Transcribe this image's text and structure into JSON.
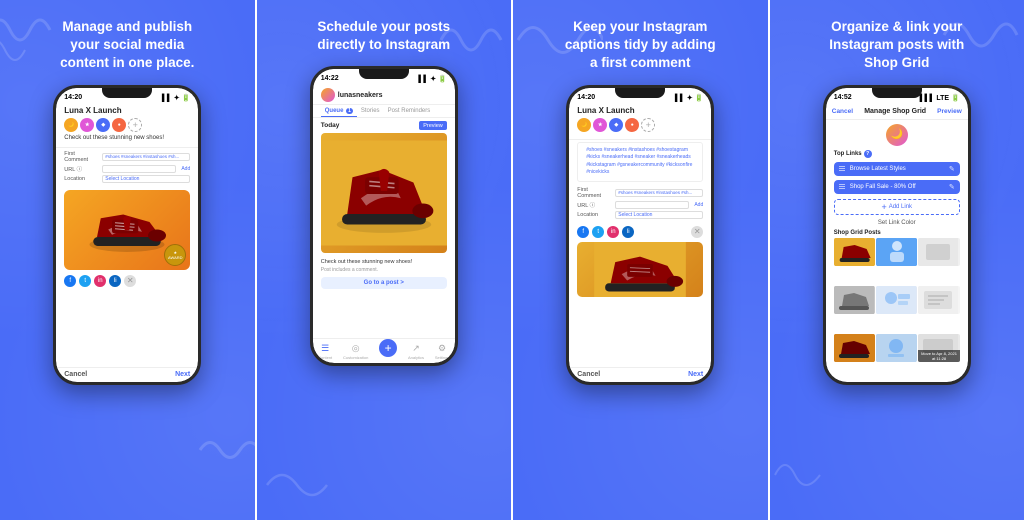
{
  "panels": [
    {
      "id": "panel1",
      "title": "Manage and publish your social media content in one place.",
      "screen": {
        "statusbar": {
          "time": "14:20",
          "signal": "▌▌▌",
          "wifi": "▾",
          "battery": "▮"
        },
        "header_title": "Luna X Launch",
        "caption": "Check out these stunning new shoes!",
        "tags": "",
        "fields": [
          {
            "label": "First Comment",
            "placeholder": "#shoes #sneakers #instashoes #sh..."
          },
          {
            "label": "URL ⓘ",
            "placeholder": "",
            "has_add": true
          },
          {
            "label": "Location",
            "placeholder": "Select Location"
          }
        ],
        "social": [
          "f",
          "t",
          "in",
          "li"
        ],
        "social_colors": [
          "#1877F2",
          "#1DA1F2",
          "#E1306C",
          "#0A66C2"
        ]
      },
      "bottom": {
        "cancel": "Cancel",
        "next": "Next"
      }
    },
    {
      "id": "panel2",
      "title": "Schedule your posts directly to Instagram",
      "screen": {
        "statusbar": {
          "time": "14:22"
        },
        "profile_name": "lunasneakers",
        "tabs": [
          "Queue",
          "Stories",
          "Post Reminders"
        ],
        "active_tab": 0,
        "queue_badge": "1",
        "section": "Today",
        "caption": "Check out these stunning new shoes!",
        "caption_sub": "Post includes a comment.",
        "goto_label": "Go to a post >"
      },
      "navbar": [
        {
          "icon": "☰",
          "label": "Content",
          "active": true
        },
        {
          "icon": "◎",
          "label": "Customization"
        },
        {
          "icon": "+",
          "label": "",
          "is_plus": true
        },
        {
          "icon": "↗",
          "label": "Analytics"
        },
        {
          "icon": "⚙",
          "label": "Settings"
        }
      ]
    },
    {
      "id": "panel3",
      "title": "Keep your Instagram captions tidy by adding a first comment",
      "screen": {
        "statusbar": {
          "time": "14:20"
        },
        "header_title": "Luna X Launch",
        "tags_text": "#shoes #sneakers #instashoes #shoestagram #kicks #sneakerhead #sneaker #sneakerheads #kickstagram #gsneakercommunity #kicksonfire #nicekicks",
        "fields": [
          {
            "label": "First Comment",
            "placeholder": "#shoes #sneakers #instashoes #sh..."
          },
          {
            "label": "URL ⓘ",
            "placeholder": "",
            "has_add": true
          },
          {
            "label": "Location",
            "placeholder": "Select Location"
          }
        ],
        "social": [
          "f",
          "t",
          "in",
          "li"
        ],
        "social_colors": [
          "#1877F2",
          "#1DA1F2",
          "#E1306C",
          "#0A66C2"
        ]
      },
      "bottom": {
        "cancel": "Cancel",
        "next": "Next"
      }
    },
    {
      "id": "panel4",
      "title": "Organize & link your Instagram posts with Shop Grid",
      "screen": {
        "statusbar": {
          "time": "14:52"
        },
        "header": {
          "cancel": "Cancel",
          "title": "Manage Shop Grid",
          "preview": "Preview"
        },
        "top_links_title": "Top Links",
        "links": [
          {
            "text": "Browse Latest Styles"
          },
          {
            "text": "Shop Fall Sale - 80% Off"
          }
        ],
        "add_link": "Add Link",
        "set_color": "Set Link Color",
        "grid_title": "Shop Grid Posts",
        "grid_colors": [
          "#e8af30",
          "#5ba4f5",
          "#f0f0f0",
          "#c8c8c8",
          "#e0e8f5",
          "#f5f5f5",
          "#d4811a",
          "#b8d4f0",
          "#e8e8e8"
        ]
      }
    }
  ]
}
